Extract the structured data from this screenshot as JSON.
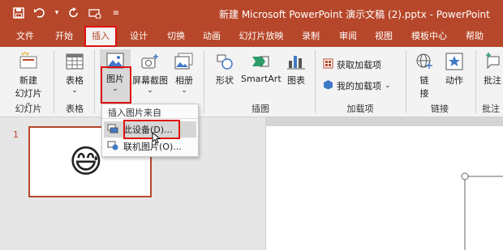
{
  "window": {
    "title": "新建 Microsoft PowerPoint 演示文稿 (2).pptx  -  PowerPoint"
  },
  "qat": {
    "icons": [
      "save-icon",
      "undo-icon",
      "redo-icon",
      "present-icon",
      "customize-icon"
    ]
  },
  "tabs": [
    {
      "label": "文件"
    },
    {
      "label": "开始"
    },
    {
      "label": "插入",
      "active": true
    },
    {
      "label": "设计"
    },
    {
      "label": "切换"
    },
    {
      "label": "动画"
    },
    {
      "label": "幻灯片放映"
    },
    {
      "label": "录制"
    },
    {
      "label": "审阅"
    },
    {
      "label": "视图"
    },
    {
      "label": "模板中心"
    },
    {
      "label": "帮助"
    }
  ],
  "ribbon": {
    "new_slide": {
      "line1": "新建",
      "line2": "幻灯片",
      "arrow": "⌄"
    },
    "table": {
      "label": "表格",
      "arrow": "⌄"
    },
    "picture": {
      "label": "图片",
      "arrow": "⌄"
    },
    "screenshot": {
      "label": "屏幕截图",
      "arrow": "⌄"
    },
    "album": {
      "label": "相册",
      "arrow": "⌄"
    },
    "shapes": {
      "label": "形状"
    },
    "smartart": {
      "label": "SmartArt"
    },
    "chart": {
      "label": "图表"
    },
    "get_addins": {
      "label": "获取加载项"
    },
    "my_addins": {
      "label": "我的加载项"
    },
    "link": {
      "line1": "链",
      "line2": "接"
    },
    "action": {
      "label": "动作"
    },
    "comment": {
      "label": "批注"
    },
    "groups": {
      "slides": "幻灯片",
      "tables": "表格",
      "illustrations": "插图",
      "addins": "加载项",
      "links": "链接",
      "comments": "批注"
    }
  },
  "picture_menu": {
    "header": "插入图片来自",
    "items": [
      {
        "label": "此设备(D)...",
        "hover": true
      },
      {
        "label": "联机图片(O)..."
      }
    ]
  },
  "slides_pane": {
    "slide_number": "1",
    "emoji": "😅"
  },
  "colors": {
    "accent": "#b7472a",
    "highlight_box": "#e01010"
  }
}
